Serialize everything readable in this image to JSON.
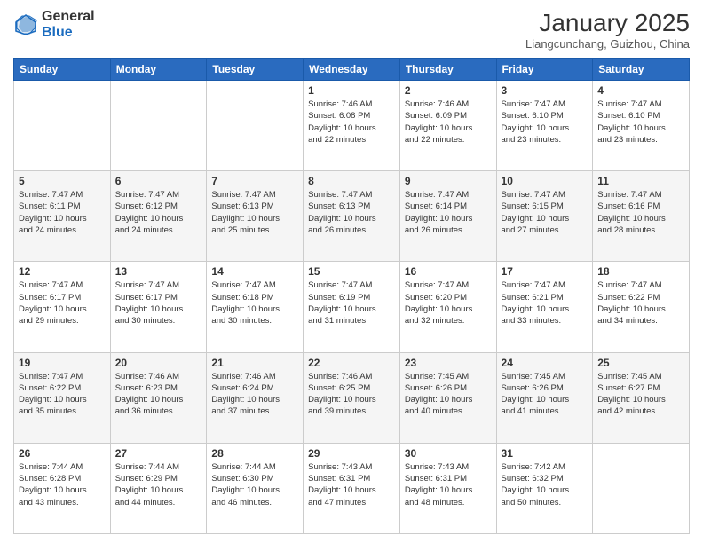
{
  "logo": {
    "general": "General",
    "blue": "Blue"
  },
  "header": {
    "month_title": "January 2025",
    "subtitle": "Liangcunchang, Guizhou, China"
  },
  "days_of_week": [
    "Sunday",
    "Monday",
    "Tuesday",
    "Wednesday",
    "Thursday",
    "Friday",
    "Saturday"
  ],
  "weeks": [
    [
      {
        "day": "",
        "info": ""
      },
      {
        "day": "",
        "info": ""
      },
      {
        "day": "",
        "info": ""
      },
      {
        "day": "1",
        "info": "Sunrise: 7:46 AM\nSunset: 6:08 PM\nDaylight: 10 hours\nand 22 minutes."
      },
      {
        "day": "2",
        "info": "Sunrise: 7:46 AM\nSunset: 6:09 PM\nDaylight: 10 hours\nand 22 minutes."
      },
      {
        "day": "3",
        "info": "Sunrise: 7:47 AM\nSunset: 6:10 PM\nDaylight: 10 hours\nand 23 minutes."
      },
      {
        "day": "4",
        "info": "Sunrise: 7:47 AM\nSunset: 6:10 PM\nDaylight: 10 hours\nand 23 minutes."
      }
    ],
    [
      {
        "day": "5",
        "info": "Sunrise: 7:47 AM\nSunset: 6:11 PM\nDaylight: 10 hours\nand 24 minutes."
      },
      {
        "day": "6",
        "info": "Sunrise: 7:47 AM\nSunset: 6:12 PM\nDaylight: 10 hours\nand 24 minutes."
      },
      {
        "day": "7",
        "info": "Sunrise: 7:47 AM\nSunset: 6:13 PM\nDaylight: 10 hours\nand 25 minutes."
      },
      {
        "day": "8",
        "info": "Sunrise: 7:47 AM\nSunset: 6:13 PM\nDaylight: 10 hours\nand 26 minutes."
      },
      {
        "day": "9",
        "info": "Sunrise: 7:47 AM\nSunset: 6:14 PM\nDaylight: 10 hours\nand 26 minutes."
      },
      {
        "day": "10",
        "info": "Sunrise: 7:47 AM\nSunset: 6:15 PM\nDaylight: 10 hours\nand 27 minutes."
      },
      {
        "day": "11",
        "info": "Sunrise: 7:47 AM\nSunset: 6:16 PM\nDaylight: 10 hours\nand 28 minutes."
      }
    ],
    [
      {
        "day": "12",
        "info": "Sunrise: 7:47 AM\nSunset: 6:17 PM\nDaylight: 10 hours\nand 29 minutes."
      },
      {
        "day": "13",
        "info": "Sunrise: 7:47 AM\nSunset: 6:17 PM\nDaylight: 10 hours\nand 30 minutes."
      },
      {
        "day": "14",
        "info": "Sunrise: 7:47 AM\nSunset: 6:18 PM\nDaylight: 10 hours\nand 30 minutes."
      },
      {
        "day": "15",
        "info": "Sunrise: 7:47 AM\nSunset: 6:19 PM\nDaylight: 10 hours\nand 31 minutes."
      },
      {
        "day": "16",
        "info": "Sunrise: 7:47 AM\nSunset: 6:20 PM\nDaylight: 10 hours\nand 32 minutes."
      },
      {
        "day": "17",
        "info": "Sunrise: 7:47 AM\nSunset: 6:21 PM\nDaylight: 10 hours\nand 33 minutes."
      },
      {
        "day": "18",
        "info": "Sunrise: 7:47 AM\nSunset: 6:22 PM\nDaylight: 10 hours\nand 34 minutes."
      }
    ],
    [
      {
        "day": "19",
        "info": "Sunrise: 7:47 AM\nSunset: 6:22 PM\nDaylight: 10 hours\nand 35 minutes."
      },
      {
        "day": "20",
        "info": "Sunrise: 7:46 AM\nSunset: 6:23 PM\nDaylight: 10 hours\nand 36 minutes."
      },
      {
        "day": "21",
        "info": "Sunrise: 7:46 AM\nSunset: 6:24 PM\nDaylight: 10 hours\nand 37 minutes."
      },
      {
        "day": "22",
        "info": "Sunrise: 7:46 AM\nSunset: 6:25 PM\nDaylight: 10 hours\nand 39 minutes."
      },
      {
        "day": "23",
        "info": "Sunrise: 7:45 AM\nSunset: 6:26 PM\nDaylight: 10 hours\nand 40 minutes."
      },
      {
        "day": "24",
        "info": "Sunrise: 7:45 AM\nSunset: 6:26 PM\nDaylight: 10 hours\nand 41 minutes."
      },
      {
        "day": "25",
        "info": "Sunrise: 7:45 AM\nSunset: 6:27 PM\nDaylight: 10 hours\nand 42 minutes."
      }
    ],
    [
      {
        "day": "26",
        "info": "Sunrise: 7:44 AM\nSunset: 6:28 PM\nDaylight: 10 hours\nand 43 minutes."
      },
      {
        "day": "27",
        "info": "Sunrise: 7:44 AM\nSunset: 6:29 PM\nDaylight: 10 hours\nand 44 minutes."
      },
      {
        "day": "28",
        "info": "Sunrise: 7:44 AM\nSunset: 6:30 PM\nDaylight: 10 hours\nand 46 minutes."
      },
      {
        "day": "29",
        "info": "Sunrise: 7:43 AM\nSunset: 6:31 PM\nDaylight: 10 hours\nand 47 minutes."
      },
      {
        "day": "30",
        "info": "Sunrise: 7:43 AM\nSunset: 6:31 PM\nDaylight: 10 hours\nand 48 minutes."
      },
      {
        "day": "31",
        "info": "Sunrise: 7:42 AM\nSunset: 6:32 PM\nDaylight: 10 hours\nand 50 minutes."
      },
      {
        "day": "",
        "info": ""
      }
    ]
  ]
}
